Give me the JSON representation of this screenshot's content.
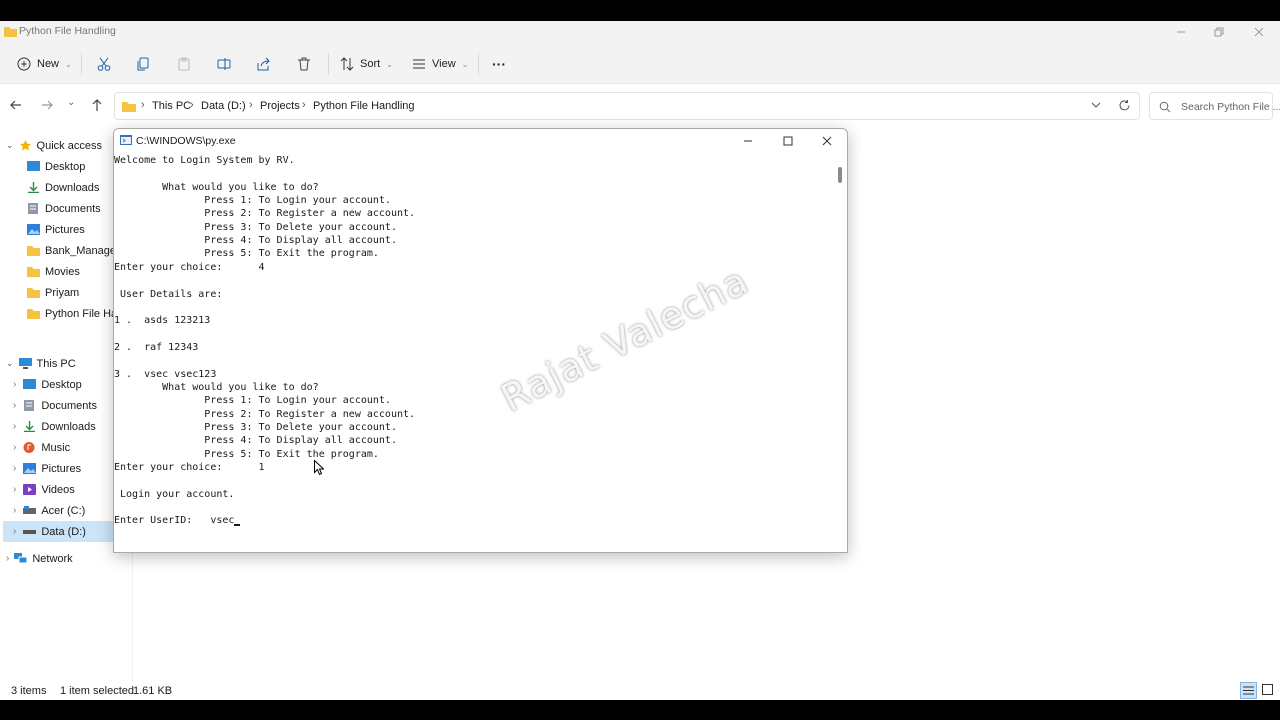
{
  "explorer": {
    "window_title": "Python File Handling",
    "toolbar": {
      "new_label": "New",
      "sort_label": "Sort",
      "view_label": "View",
      "more_label": "···"
    },
    "breadcrumb": [
      "This PC",
      "Data (D:)",
      "Projects",
      "Python File Handling"
    ],
    "search_placeholder": "Search Python File ...",
    "sidebar": {
      "quick_access": "Quick access",
      "quick_items": [
        "Desktop",
        "Downloads",
        "Documents",
        "Pictures",
        "Bank_Managem",
        "Movies",
        "Priyam",
        "Python File Han"
      ],
      "this_pc": "This PC",
      "pc_items": [
        "Desktop",
        "Documents",
        "Downloads",
        "Music",
        "Pictures",
        "Videos",
        "Acer (C:)",
        "Data (D:)"
      ],
      "network": "Network"
    },
    "status": {
      "items": "3 items",
      "selected": "1 item selected",
      "size": "1.61 KB"
    }
  },
  "console": {
    "title": "C:\\WINDOWS\\py.exe",
    "lines": [
      "Welcome to Login System by RV.",
      "",
      "        What would you like to do?",
      "               Press 1: To Login your account.",
      "               Press 2: To Register a new account.",
      "               Press 3: To Delete your account.",
      "               Press 4: To Display all account.",
      "               Press 5: To Exit the program.",
      "Enter your choice:      4",
      "",
      " User Details are:",
      "",
      "1 .  asds 123213",
      "",
      "2 .  raf 12343",
      "",
      "3 .  vsec vsec123",
      "        What would you like to do?",
      "               Press 1: To Login your account.",
      "               Press 2: To Register a new account.",
      "               Press 3: To Delete your account.",
      "               Press 4: To Display all account.",
      "               Press 5: To Exit the program.",
      "Enter your choice:      1",
      "",
      " Login your account.",
      "",
      "Enter UserID:   vsec"
    ]
  },
  "watermark": "Rajat Valecha",
  "colors": {
    "accent": "#0067c0",
    "folder": "#f5c342",
    "selection": "#cce4f7"
  }
}
